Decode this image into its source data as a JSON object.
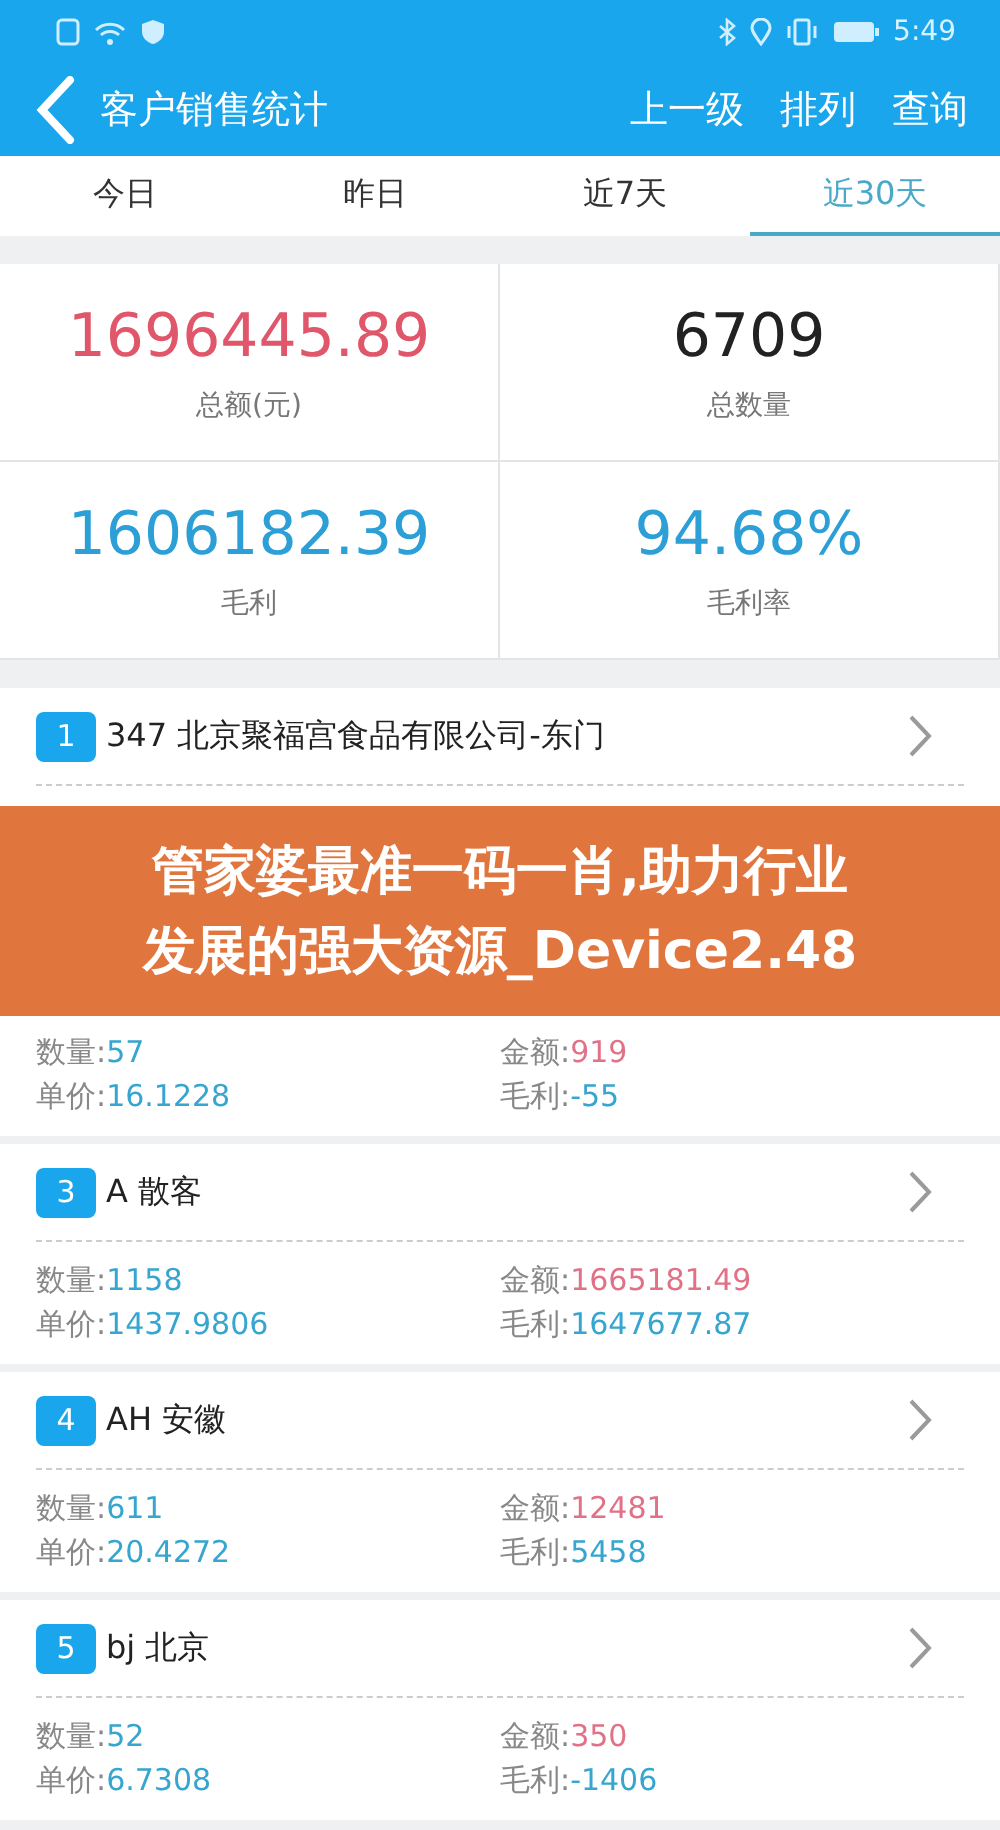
{
  "status_bar": {
    "time": "5:49"
  },
  "header": {
    "title": "客户销售统计",
    "actions": [
      "上一级",
      "排列",
      "查询"
    ]
  },
  "tabs": [
    {
      "label": "今日",
      "selected": false
    },
    {
      "label": "昨日",
      "selected": false
    },
    {
      "label": "近7天",
      "selected": false
    },
    {
      "label": "近30天",
      "selected": true
    }
  ],
  "summary": [
    {
      "value": "1696445.89",
      "label": "总额(元)",
      "kind": "amount"
    },
    {
      "value": "6709",
      "label": "总数量",
      "kind": "count"
    },
    {
      "value": "1606182.39",
      "label": "毛利",
      "kind": "profit"
    },
    {
      "value": "94.68%",
      "label": "毛利率",
      "kind": "profit"
    }
  ],
  "customers": [
    {
      "rank": "1",
      "name": "347 北京聚福宫食品有限公司-东门"
    },
    {
      "stats": [
        {
          "label": "数量:",
          "value": "57",
          "kind": "number"
        },
        {
          "label": "金额:",
          "value": "919",
          "kind": "money"
        },
        {
          "label": "单价:",
          "value": "16.1228",
          "kind": "number"
        },
        {
          "label": "毛利:",
          "value": "-55",
          "kind": "number"
        }
      ]
    },
    {
      "rank": "3",
      "name": "A 散客",
      "stats": [
        {
          "label": "数量:",
          "value": "1158",
          "kind": "number"
        },
        {
          "label": "金额:",
          "value": "1665181.49",
          "kind": "money"
        },
        {
          "label": "单价:",
          "value": "1437.9806",
          "kind": "number"
        },
        {
          "label": "毛利:",
          "value": "1647677.87",
          "kind": "number"
        }
      ]
    },
    {
      "rank": "4",
      "name": "AH 安徽",
      "stats": [
        {
          "label": "数量:",
          "value": "611",
          "kind": "number"
        },
        {
          "label": "金额:",
          "value": "12481",
          "kind": "money"
        },
        {
          "label": "单价:",
          "value": "20.4272",
          "kind": "number"
        },
        {
          "label": "毛利:",
          "value": "5458",
          "kind": "number"
        }
      ]
    },
    {
      "rank": "5",
      "name": "bj 北京",
      "stats": [
        {
          "label": "数量:",
          "value": "52",
          "kind": "number"
        },
        {
          "label": "金额:",
          "value": "350",
          "kind": "money"
        },
        {
          "label": "单价:",
          "value": "6.7308",
          "kind": "number"
        },
        {
          "label": "毛利:",
          "value": "-1406",
          "kind": "number"
        }
      ]
    }
  ],
  "banner": {
    "lines": [
      "管家婆最准一码一肖,助力行业",
      "发展的强大资源_Device2.48"
    ]
  }
}
